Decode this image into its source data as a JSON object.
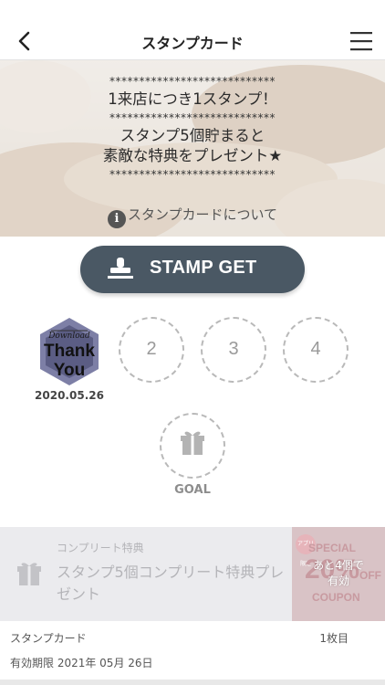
{
  "nav": {
    "title": "スタンプカード"
  },
  "hero": {
    "stars_top": "****************************",
    "line1": "1来店につき1スタンプ！",
    "stars_mid": "****************************",
    "line2": "スタンプ5個貯まると",
    "line3": "素敵な特典をプレゼント★",
    "stars_bottom": "****************************",
    "info_link": "スタンプカードについて"
  },
  "stamp_button": {
    "label": "STAMP GET"
  },
  "stamps": {
    "first": {
      "image_text_top": "Download",
      "image_text_1": "Thank",
      "image_text_2": "You",
      "date": "2020.05.26"
    },
    "slots": [
      "2",
      "3",
      "4"
    ],
    "goal_label": "GOAL"
  },
  "complete": {
    "caption": "コンプリート特典",
    "description": "スタンプ5個コンプリート特典プレゼント"
  },
  "coupon": {
    "badge": "アプリ限定",
    "special": "SPECIAL",
    "percent": "20%",
    "off": "OFF",
    "coupon_text": "COUPON",
    "remaining_line1": "あと4個で",
    "remaining_line2": "有効"
  },
  "footer": {
    "card_name": "スタンプカード",
    "card_count": "1枚目",
    "expiry": "有効期限 2021年 05月 26日"
  },
  "colors": {
    "button": "#4a5864",
    "dashed_border": "#b9b9b9",
    "thankyou_badge": "#4a4e63"
  }
}
